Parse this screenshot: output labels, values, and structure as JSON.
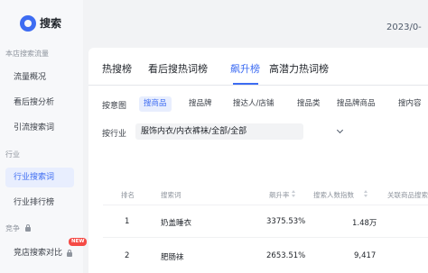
{
  "app": {
    "title": "搜索"
  },
  "header": {
    "date": "2023/0-"
  },
  "sidebar": {
    "sections": [
      {
        "label": "本店搜索流量"
      },
      {
        "label": "行业"
      },
      {
        "label": "竞争"
      }
    ],
    "items": [
      {
        "label": "流量概况"
      },
      {
        "label": "看后搜分析"
      },
      {
        "label": "引流搜索词"
      },
      {
        "label": "行业搜索词"
      },
      {
        "label": "行业排行榜"
      },
      {
        "label": "竞店搜索对比"
      }
    ],
    "new_badge": "NEW"
  },
  "tabs": [
    {
      "label": "热搜榜"
    },
    {
      "label": "看后搜热词榜"
    },
    {
      "label": "飙升榜"
    },
    {
      "label": "高潜力热词榜"
    }
  ],
  "filters": {
    "intent_label": "按意图",
    "intent_options": [
      {
        "label": "搜商品"
      },
      {
        "label": "搜品牌"
      },
      {
        "label": "搜达人/店铺"
      },
      {
        "label": "搜品类"
      },
      {
        "label": "搜品牌商品"
      },
      {
        "label": "搜内容"
      }
    ],
    "industry_label": "按行业",
    "industry_value": "服饰内衣/内衣裤袜/全部/全部"
  },
  "table": {
    "headers": [
      "排名",
      "搜索词",
      "飙升率",
      "搜索人数指数",
      "关联商品搜索"
    ],
    "rows": [
      {
        "rank": "1",
        "term": "奶盖睡衣",
        "rate": "3375.53%",
        "index": "1.48万"
      },
      {
        "rank": "2",
        "term": "肥肠袜",
        "rate": "2653.51%",
        "index": "9,417"
      }
    ]
  }
}
